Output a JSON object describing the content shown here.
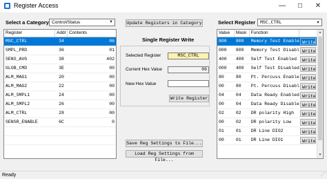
{
  "window": {
    "title": "Register Access",
    "minimize": "—",
    "maximize": "☐",
    "close": "✕"
  },
  "left": {
    "category_label": "Select a Category",
    "category_value": "Control/Status",
    "columns": [
      "Register",
      "Addr",
      "Contents"
    ],
    "rows": [
      {
        "register": "MSC_CTRL",
        "addr": "34",
        "contents": "06"
      },
      {
        "register": "SMPL_PRD",
        "addr": "36",
        "contents": "01"
      },
      {
        "register": "SENS_AVG",
        "addr": "38",
        "contents": "402"
      },
      {
        "register": "GLOB_CMD",
        "addr": "3E",
        "contents": "00"
      },
      {
        "register": "ALM_MAG1",
        "addr": "20",
        "contents": "00"
      },
      {
        "register": "ALM_MAG2",
        "addr": "22",
        "contents": "00"
      },
      {
        "register": "ALM_SMPL1",
        "addr": "24",
        "contents": "00"
      },
      {
        "register": "ALM_SMPL2",
        "addr": "26",
        "contents": "00"
      },
      {
        "register": "ALM_CTRL",
        "addr": "28",
        "contents": "00"
      },
      {
        "register": "SENSR_ENABLE",
        "addr": "6C",
        "contents": "0"
      },
      {
        "register": "",
        "addr": "",
        "contents": ""
      },
      {
        "register": "",
        "addr": "",
        "contents": ""
      }
    ]
  },
  "middle": {
    "update_button": "Update Registers in Category",
    "group_title": "Single Register Write",
    "selected_register_label": "Selected Register",
    "selected_register_value": "MSC_CTRL",
    "current_hex_label": "Current Hex Value",
    "current_hex_value": "06",
    "new_hex_label": "New Hex Value",
    "new_hex_value": "",
    "write_button": "Write Register",
    "save_button": "Save Reg Settings to File...",
    "load_button": "Load Reg Settings from File..."
  },
  "right": {
    "select_label": "Select Register",
    "select_value": "MSC_CTRL",
    "columns": [
      "Value",
      "Mask",
      "Function",
      ""
    ],
    "write_label": "Write",
    "rows": [
      {
        "value": "800",
        "mask": "800",
        "function": "Memory Test Enabled"
      },
      {
        "value": "000",
        "mask": "800",
        "function": "Memory Test Disabled"
      },
      {
        "value": "400",
        "mask": "400",
        "function": "Self Test Enabled"
      },
      {
        "value": "000",
        "mask": "400",
        "function": "Self Test Disabled"
      },
      {
        "value": "80",
        "mask": "80",
        "function": "Pt. Percuss Enabled"
      },
      {
        "value": "00",
        "mask": "80",
        "function": "Pt. Percuss Disabled"
      },
      {
        "value": "04",
        "mask": "04",
        "function": "Data Ready Enabled"
      },
      {
        "value": "00",
        "mask": "04",
        "function": "Data Ready Disabled"
      },
      {
        "value": "02",
        "mask": "02",
        "function": "DR polarity High"
      },
      {
        "value": "00",
        "mask": "02",
        "function": "DR polarity Low"
      },
      {
        "value": "01",
        "mask": "01",
        "function": "DR Line DIO2"
      },
      {
        "value": "00",
        "mask": "01",
        "function": "DR Line DIO1"
      }
    ]
  },
  "status": {
    "text": "Ready"
  }
}
